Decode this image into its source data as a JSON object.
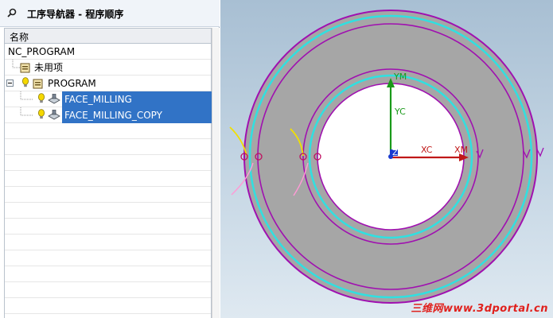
{
  "navigator": {
    "title": "工序导航器 - 程序顺序",
    "column_header": "名称",
    "rows": [
      {
        "label": "NC_PROGRAM"
      },
      {
        "label": "未用项"
      },
      {
        "label": "PROGRAM"
      },
      {
        "label": "FACE_MILLING",
        "selected": true
      },
      {
        "label": "FACE_MILLING_COPY",
        "selected": true
      }
    ]
  },
  "viewport": {
    "axes": {
      "ym": "YM",
      "yc": "YC",
      "zm": "ZM",
      "xc": "XC",
      "xm": "XM"
    },
    "watermark": "三维网www.3dportal.cn"
  },
  "colors": {
    "selection": "#3173c6",
    "part_gray": "#a6a6a6",
    "boundary_purple": "#a010b0",
    "tool_path_cyan": "#30e0e0",
    "axis_green": "#1a9a1a",
    "axis_red": "#c01818",
    "watermark_red": "#e0201c"
  }
}
